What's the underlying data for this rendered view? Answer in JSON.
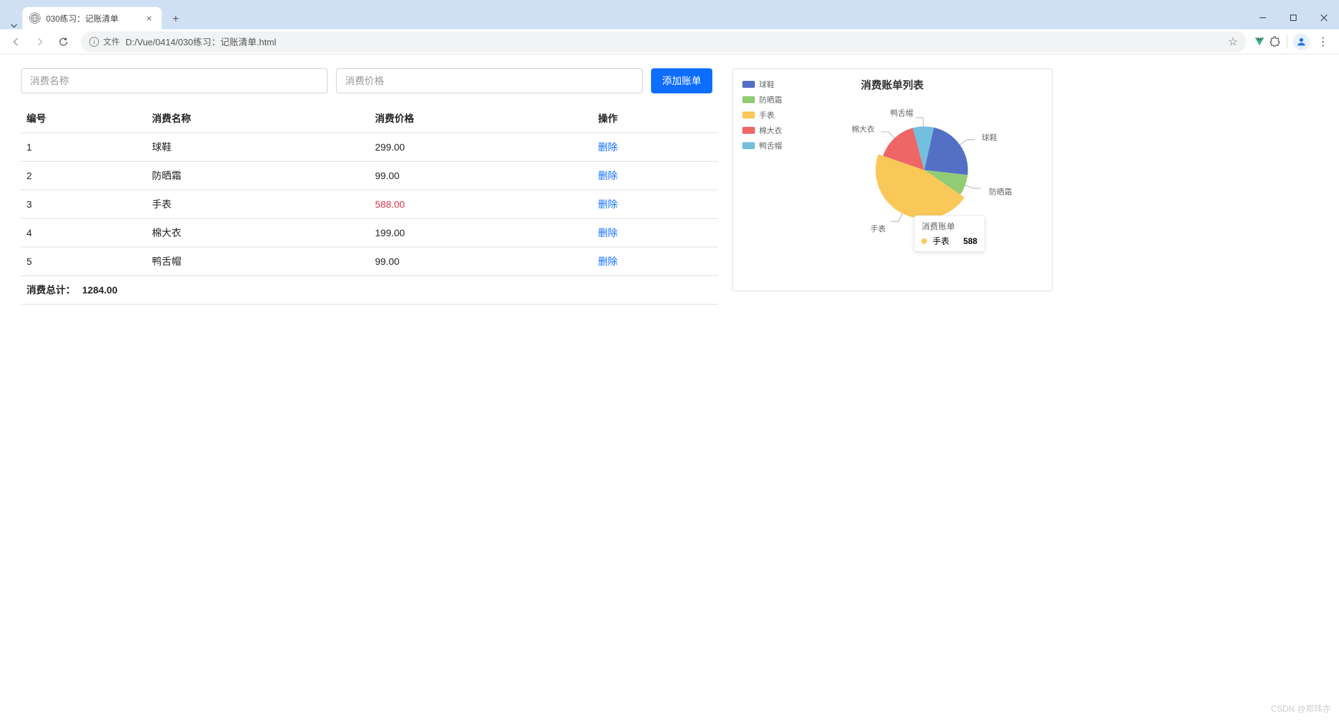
{
  "browser": {
    "tab_title": "030练习：记账清单",
    "url_scheme_label": "文件",
    "url_path": "D:/Vue/0414/030练习：记账清单.html",
    "win_min": "—",
    "win_max": "▢",
    "win_close": "✕"
  },
  "form": {
    "name_placeholder": "消费名称",
    "price_placeholder": "消费价格",
    "add_label": "添加账单"
  },
  "table": {
    "headers": {
      "id": "编号",
      "name": "消费名称",
      "price": "消费价格",
      "action": "操作"
    },
    "delete_label": "删除",
    "total_label": "消费总计：",
    "total_value": "1284.00",
    "rows": [
      {
        "id": "1",
        "name": "球鞋",
        "price": "299.00",
        "highlight": false
      },
      {
        "id": "2",
        "name": "防晒霜",
        "price": "99.00",
        "highlight": false
      },
      {
        "id": "3",
        "name": "手表",
        "price": "588.00",
        "highlight": true
      },
      {
        "id": "4",
        "name": "棉大衣",
        "price": "199.00",
        "highlight": false
      },
      {
        "id": "5",
        "name": "鸭舌帽",
        "price": "99.00",
        "highlight": false
      }
    ]
  },
  "chart": {
    "title": "消费账单列表",
    "tooltip": {
      "series_title": "消费账单",
      "name": "手表",
      "value": "588"
    }
  },
  "watermark": "CSDN @郑玮亦",
  "chart_data": {
    "type": "pie",
    "title": "消费账单列表",
    "series_name": "消费账单",
    "data": [
      {
        "name": "球鞋",
        "value": 299,
        "color": "#5470c6"
      },
      {
        "name": "防晒霜",
        "value": 99,
        "color": "#91cc75"
      },
      {
        "name": "手表",
        "value": 588,
        "color": "#fac858"
      },
      {
        "name": "棉大衣",
        "value": 199,
        "color": "#ee6666"
      },
      {
        "name": "鸭舌帽",
        "value": 99,
        "color": "#73c0de"
      }
    ],
    "highlighted_slice": "手表",
    "legend_position": "top-left"
  }
}
